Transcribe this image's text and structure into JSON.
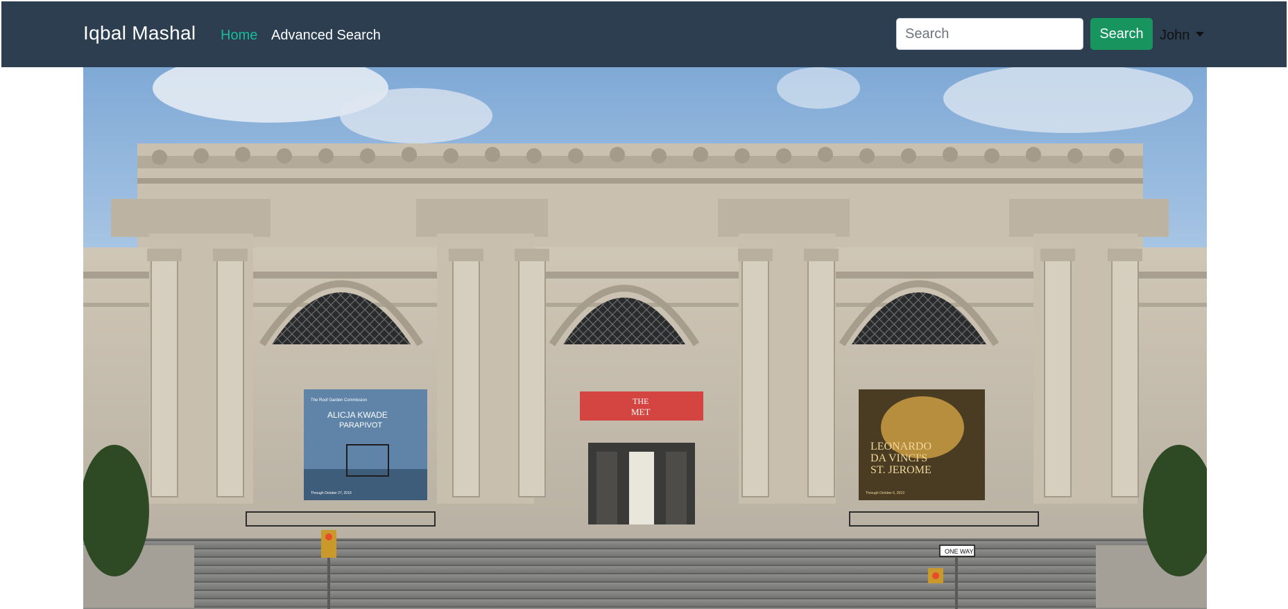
{
  "navbar": {
    "brand": "Iqbal Mashal",
    "links": [
      {
        "label": "Home",
        "active": true
      },
      {
        "label": "Advanced Search",
        "active": false
      }
    ],
    "search": {
      "placeholder": "Search",
      "value": "",
      "button_label": "Search"
    },
    "user_menu": {
      "label": "John",
      "icon": "caret-down-icon"
    }
  },
  "hero": {
    "subject": "museum-facade-photo",
    "banners": {
      "left": {
        "kicker": "The Roof Garden Commission",
        "artist": "ALICJA KWADE",
        "title": "PARAPIVOT",
        "dates": "Through October 27, 2019"
      },
      "center": {
        "logo_top": "THE",
        "logo_bottom": "MET"
      },
      "right": {
        "line1": "LEONARDO",
        "line2": "DA VINCI'S",
        "line3": "ST. JEROME",
        "dates": "Through October 6, 2019"
      }
    },
    "street_sign": "ONE WAY"
  },
  "colors": {
    "navbar_bg": "#2c3e50",
    "active_link": "#18bc9c",
    "search_button": "#18945e"
  }
}
